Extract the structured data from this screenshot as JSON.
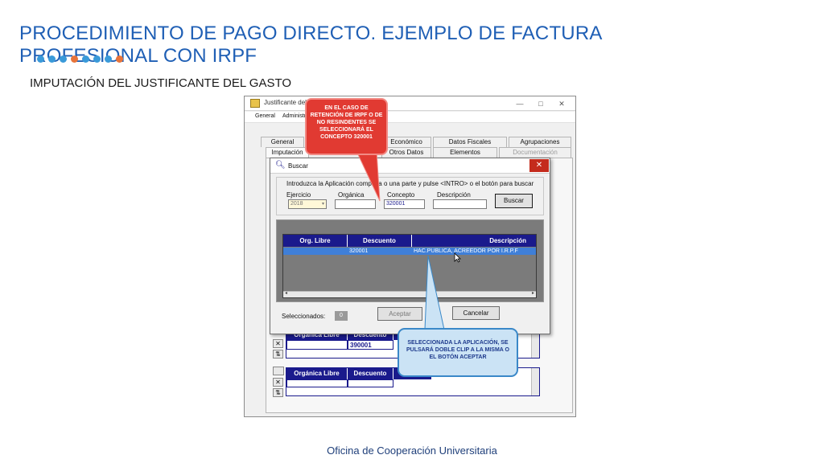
{
  "slide": {
    "title": "PROCEDIMIENTO DE PAGO DIRECTO. EJEMPLO DE FACTURA PROFESIONAL CON IRPF",
    "subtitle": "IMPUTACIÓN DEL JUSTIFICANTE DEL GASTO",
    "footer": "Oficina de Cooperación Universitaria",
    "accent_color": "#1f5fb5",
    "dot_colors": [
      "#3a9ad9",
      "#3a9ad9",
      "#3a9ad9",
      "#e8743a",
      "#3a9ad9",
      "#3a9ad9",
      "#3a9ad9",
      "#e8743a"
    ]
  },
  "main_window": {
    "title": "Justificante del g...",
    "controls": [
      "—",
      "□",
      "✕"
    ],
    "menu": [
      "General",
      "Administr..."
    ],
    "tabs_row1": [
      "General",
      "Económico",
      "Datos Fiscales",
      "Agrupaciones"
    ],
    "tabs_row2": [
      "Imputación",
      "Otros Datos",
      "Elementos",
      "Documentación"
    ],
    "grid1": {
      "headers": [
        "Orgánica Libre",
        "Descuento"
      ],
      "row_value": "390001"
    },
    "grid2": {
      "headers": [
        "Orgánica Libre",
        "Descuento"
      ]
    },
    "side_icons": [
      "delete-icon",
      "sort-icon"
    ]
  },
  "dialog": {
    "title": "Buscar",
    "close": "✕",
    "instruction": "Introduzca la Aplicación completa o una parte y pulse <INTRO> o el botón para buscar",
    "labels": {
      "ejercicio": "Ejercicio",
      "organica": "Orgánica",
      "concepto": "Concepto",
      "descripcion": "Descripción"
    },
    "values": {
      "ejercicio": "2018",
      "organica": "",
      "concepto": "320001",
      "descripcion": ""
    },
    "search_button": "Buscar",
    "results": {
      "headers": [
        "Org. Libre",
        "Descuento",
        "Descripción"
      ],
      "rows": [
        {
          "org": "",
          "descuento": "320001",
          "descripcion": "HAC.PUBLICA, ACREEDOR POR I.R.P.F"
        }
      ]
    },
    "selected_label": "Seleccionados:",
    "selected_count": "0",
    "accept_button": "Aceptar",
    "cancel_button": "Cancelar"
  },
  "callouts": {
    "red": "EN EL CASO DE RETENCIÓN DE IRPF O DE NO RESINDENTES SE SELECCIONARÁ EL CONCEPTO 320001",
    "blue": "SELECCIONADA LA APLICACIÓN, SE PULSARÁ DOBLE CLIP A LA MISMA O EL BOTÓN ACEPTAR"
  }
}
